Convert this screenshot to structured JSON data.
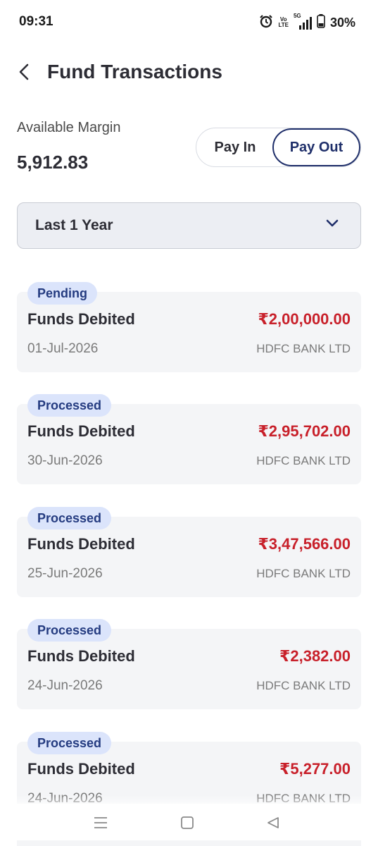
{
  "status_bar": {
    "time": "09:31",
    "volte_top": "Vo",
    "volte_bottom": "LTE",
    "network": "5G",
    "battery": "30%"
  },
  "header": {
    "title": "Fund Transactions"
  },
  "margin": {
    "label": "Available Margin",
    "value": "5,912.83"
  },
  "toggle": {
    "pay_in": "Pay In",
    "pay_out": "Pay Out",
    "selected": "Pay Out"
  },
  "filter": {
    "selected": "Last 1 Year"
  },
  "transactions": [
    {
      "status": "Pending",
      "title": "Funds Debited",
      "amount": "₹2,00,000.00",
      "date": "01-Jul-2026",
      "bank": "HDFC BANK LTD"
    },
    {
      "status": "Processed",
      "title": "Funds Debited",
      "amount": "₹2,95,702.00",
      "date": "30-Jun-2026",
      "bank": "HDFC BANK LTD"
    },
    {
      "status": "Processed",
      "title": "Funds Debited",
      "amount": "₹3,47,566.00",
      "date": "25-Jun-2026",
      "bank": "HDFC BANK LTD"
    },
    {
      "status": "Processed",
      "title": "Funds Debited",
      "amount": "₹2,382.00",
      "date": "24-Jun-2026",
      "bank": "HDFC BANK LTD"
    },
    {
      "status": "Processed",
      "title": "Funds Debited",
      "amount": "₹5,277.00",
      "date": "24-Jun-2026",
      "bank": "HDFC BANK LTD"
    }
  ],
  "colors": {
    "accent": "#1f2f6a",
    "debit_red": "#c8202a",
    "badge_bg": "#dbe4fb",
    "card_bg": "#f4f5f7"
  },
  "icons": {
    "back": "chevron-left-icon",
    "filter": "chevron-down-icon",
    "nav": [
      "menu-icon",
      "home-square-icon",
      "back-triangle-icon"
    ]
  }
}
